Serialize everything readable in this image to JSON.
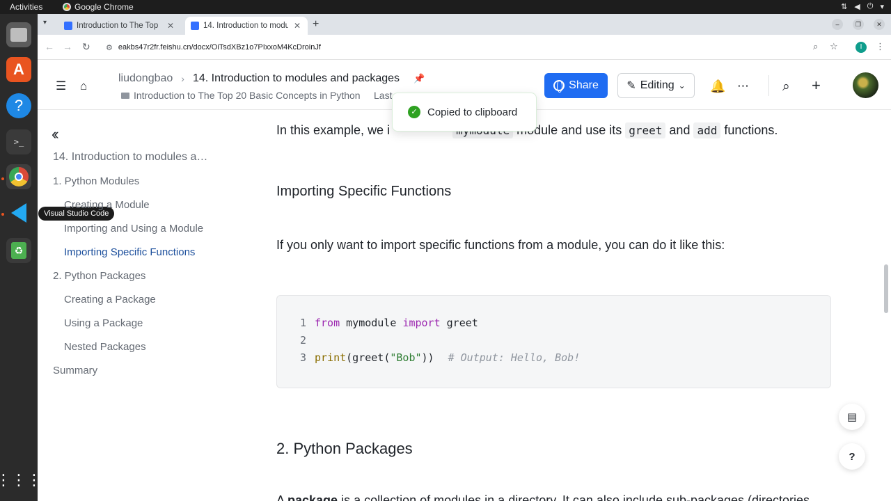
{
  "os": {
    "activities": "Activities",
    "active_app": "Google Chrome",
    "dock_tooltip": "Visual Studio Code"
  },
  "browser": {
    "tabs": [
      {
        "title": "Introduction to The Top"
      },
      {
        "title": "14. Introduction to modu"
      }
    ],
    "url": "eakbs47r2fr.feishu.cn/docx/OiTsdXBz1o7PIxxoM4KcDroinJf",
    "profile_initial": "I"
  },
  "header": {
    "owner": "liudongbao",
    "doc_title": "14. Introduction to modules and packages",
    "parent": "Introduction to The Top 20 Basic Concepts in Python",
    "last_modified": "Last",
    "share_label": "Share",
    "editing_label": "Editing"
  },
  "toast": {
    "message": "Copied to clipboard"
  },
  "toc": {
    "items": [
      "14. Introduction to modules a…",
      "1. Python Modules",
      "Creating a Module",
      "Importing and Using a Module",
      "Importing Specific Functions",
      "2. Python Packages",
      "Creating a Package",
      "Using a Package",
      "Nested Packages",
      "Summary"
    ],
    "active_index": 4
  },
  "content": {
    "para1_pre": "In this example, we i",
    "para1_code1": "mymodule",
    "para1_mid": " module and use its ",
    "para1_code2": "greet",
    "para1_and": " and ",
    "para1_code3": "add",
    "para1_post": " functions.",
    "heading1": "Importing Specific Functions",
    "para2": "If you only want to import specific functions from a module, you can do it like this:",
    "code": {
      "line_numbers": [
        "1",
        "2",
        "3"
      ],
      "l1_from": "from",
      "l1_mod": " mymodule ",
      "l1_import": "import",
      "l1_name": " greet",
      "l3_print": "print",
      "l3_open": "(greet(",
      "l3_str": "\"Bob\"",
      "l3_close": "))",
      "l3_comment": "# Output: Hello, Bob!"
    },
    "heading2": "2. Python Packages",
    "para3_pre": "A ",
    "para3_bold": "package",
    "para3_post": " is a collection of modules in a directory. It can also include sub-packages (directories"
  },
  "colors": {
    "share_blue": "#1f6cf2",
    "toast_green": "#2ea121",
    "keyword": "#9c27b0",
    "string": "#2e7d32",
    "comment": "#8f959e"
  }
}
